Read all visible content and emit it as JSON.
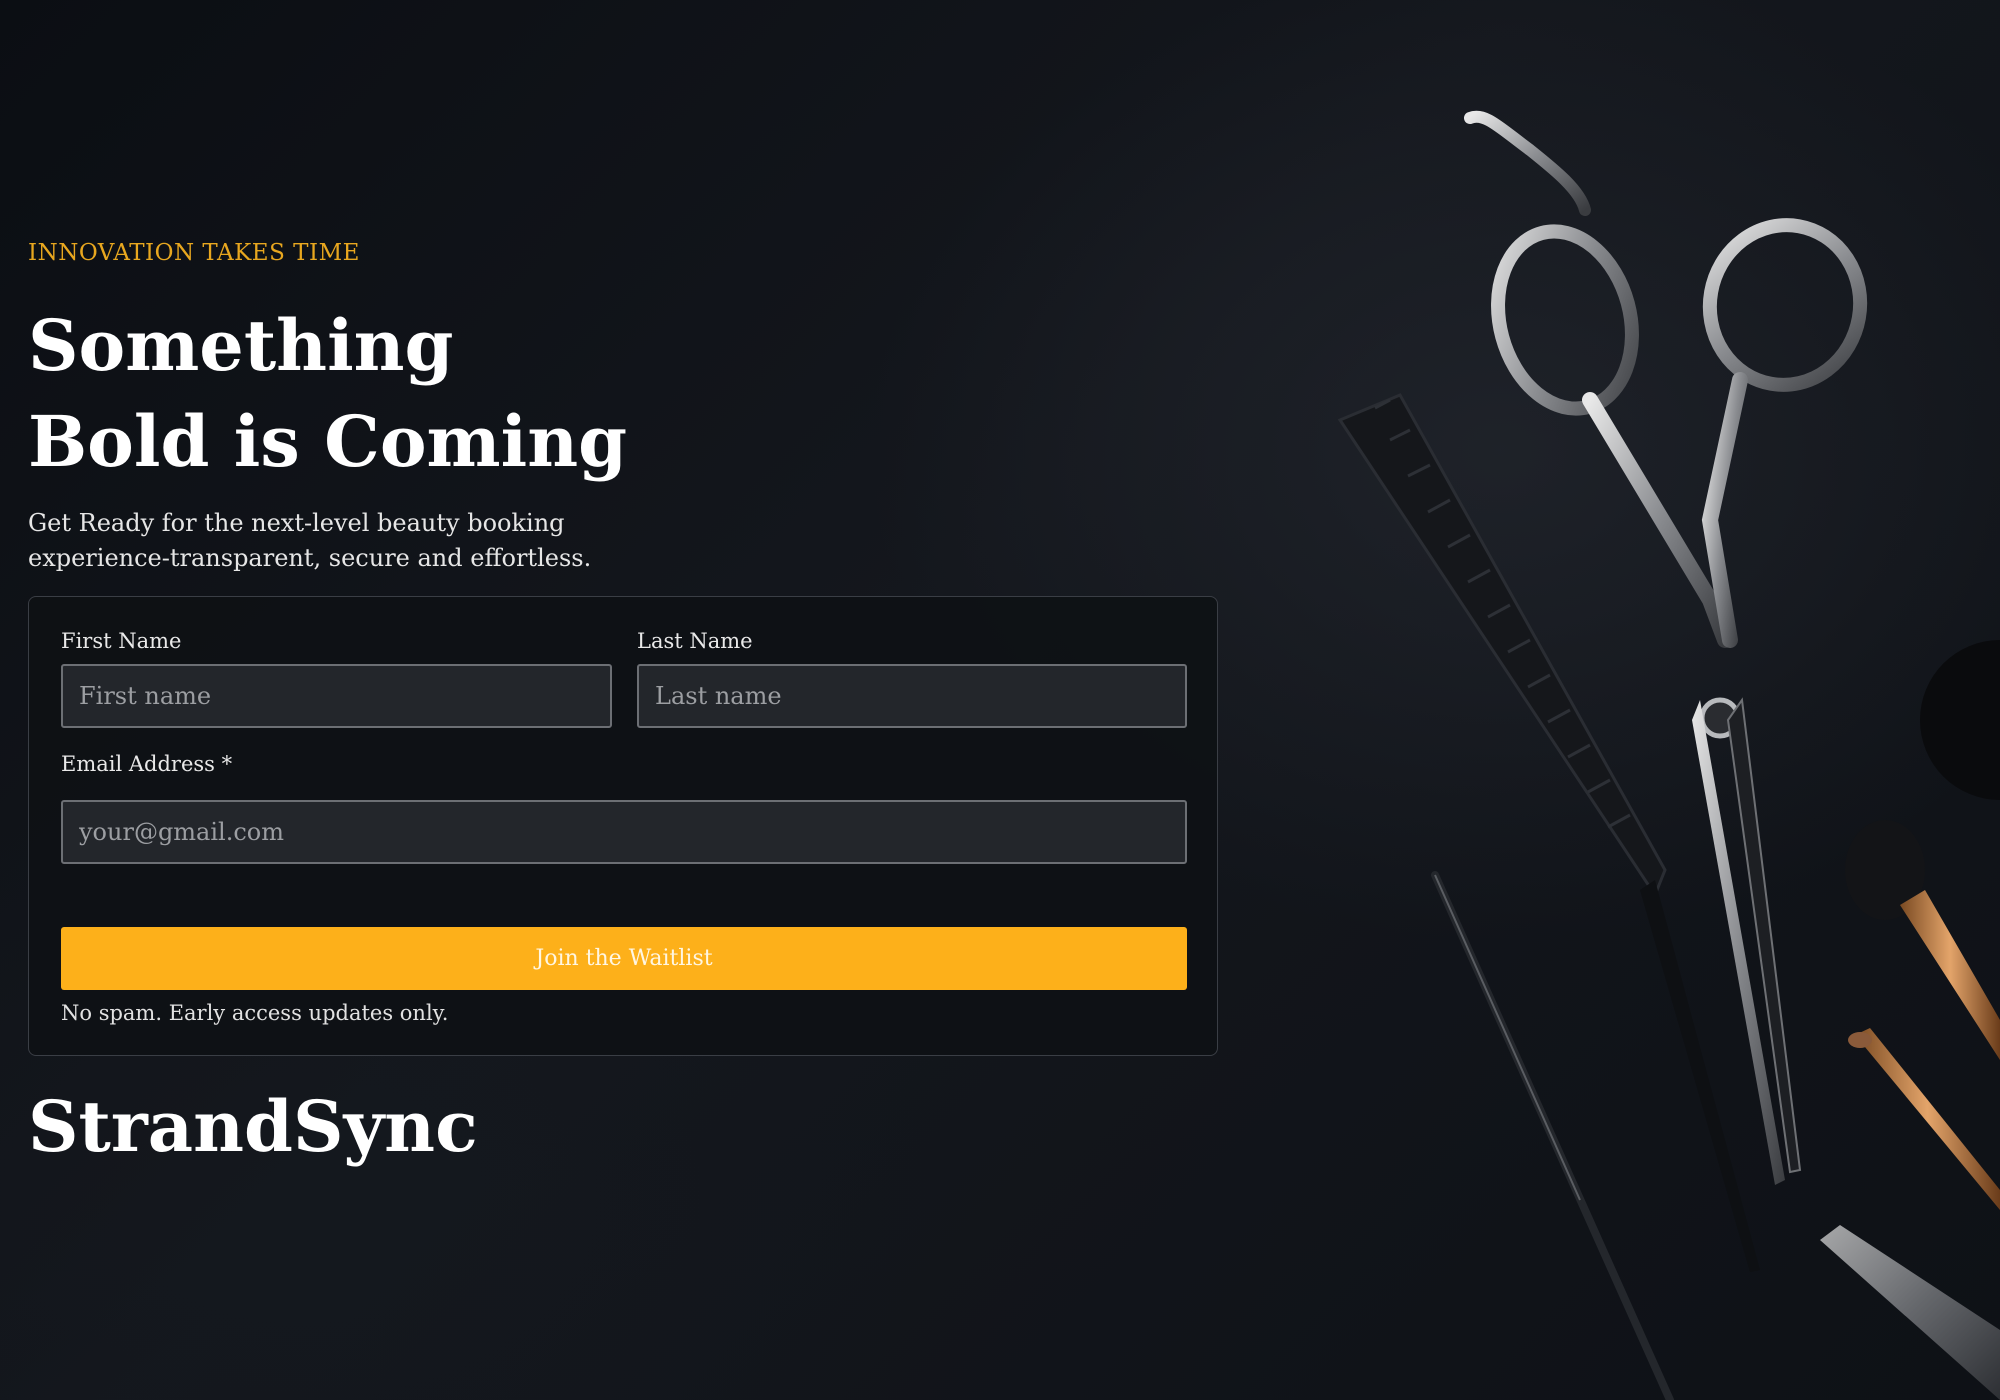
{
  "hero": {
    "eyebrow": "INNOVATION TAKES TIME",
    "headline_line1": "Something",
    "headline_line2": "Bold is Coming",
    "subtitle": "Get Ready for the next-level beauty booking experience-transparent, secure and effortless."
  },
  "form": {
    "first_name_label": "First Name",
    "first_name_placeholder": "First name",
    "last_name_label": "Last Name",
    "last_name_placeholder": "Last name",
    "email_label": "Email Address *",
    "email_placeholder": "your@gmail.com",
    "submit_label": "Join the Waitlist",
    "note": "No spam. Early access updates only."
  },
  "brand": {
    "name": "StrandSync"
  },
  "colors": {
    "accent": "#fdb01a",
    "eyebrow": "#e8a71f",
    "background": "#0d1014"
  },
  "background_image": {
    "icons": [
      "scissors-icon",
      "comb-icon",
      "makeup-brush-icon",
      "pick-icon"
    ]
  }
}
